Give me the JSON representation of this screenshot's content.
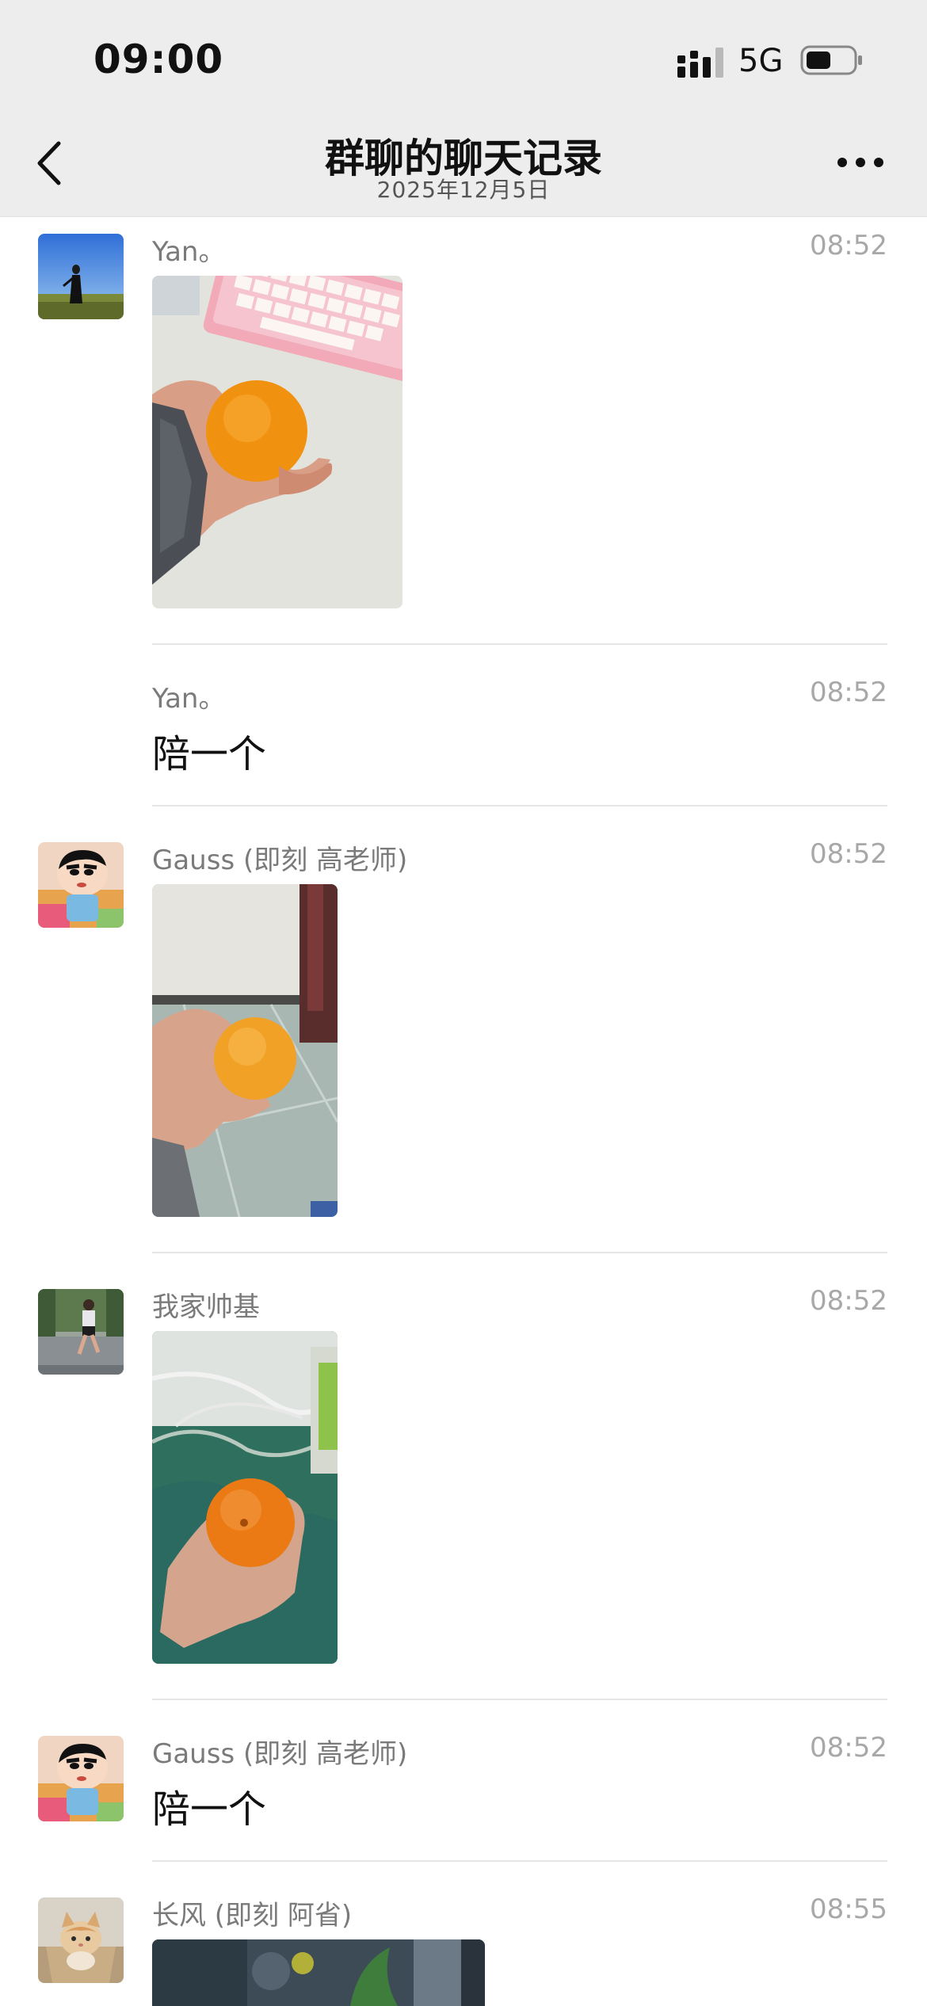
{
  "status_bar": {
    "time": "09:00",
    "network": "5G",
    "icons": [
      "signal-icon",
      "battery-icon"
    ]
  },
  "header": {
    "title": "群聊的聊天记录",
    "subtitle": "2025年12月5日",
    "back_icon": "chevron-left-icon",
    "more_icon": "more-dots-icon"
  },
  "messages": [
    {
      "sender": "Yan。",
      "time": "08:52",
      "type": "image",
      "image": "hand holding orange near pink keyboard"
    },
    {
      "sender": "Yan。",
      "time": "08:52",
      "type": "text",
      "text": "陪一个"
    },
    {
      "sender": "Gauss (即刻 高老师)",
      "time": "08:52",
      "type": "image",
      "image": "hand holding orange over floor tiles"
    },
    {
      "sender": "我家帅基",
      "time": "08:52",
      "type": "image",
      "image": "hand holding tangerine over desk mat"
    },
    {
      "sender": "Gauss (即刻 高老师)",
      "time": "08:52",
      "type": "text",
      "text": "陪一个"
    },
    {
      "sender": "长风 (即刻 阿省)",
      "time": "08:55",
      "type": "image",
      "image": "dark photo partially visible"
    }
  ],
  "colors": {
    "header_bg": "#ededed",
    "sender_text": "#7a7a7a",
    "time_text": "#a8a8a8",
    "divider": "#e6e6e6"
  }
}
